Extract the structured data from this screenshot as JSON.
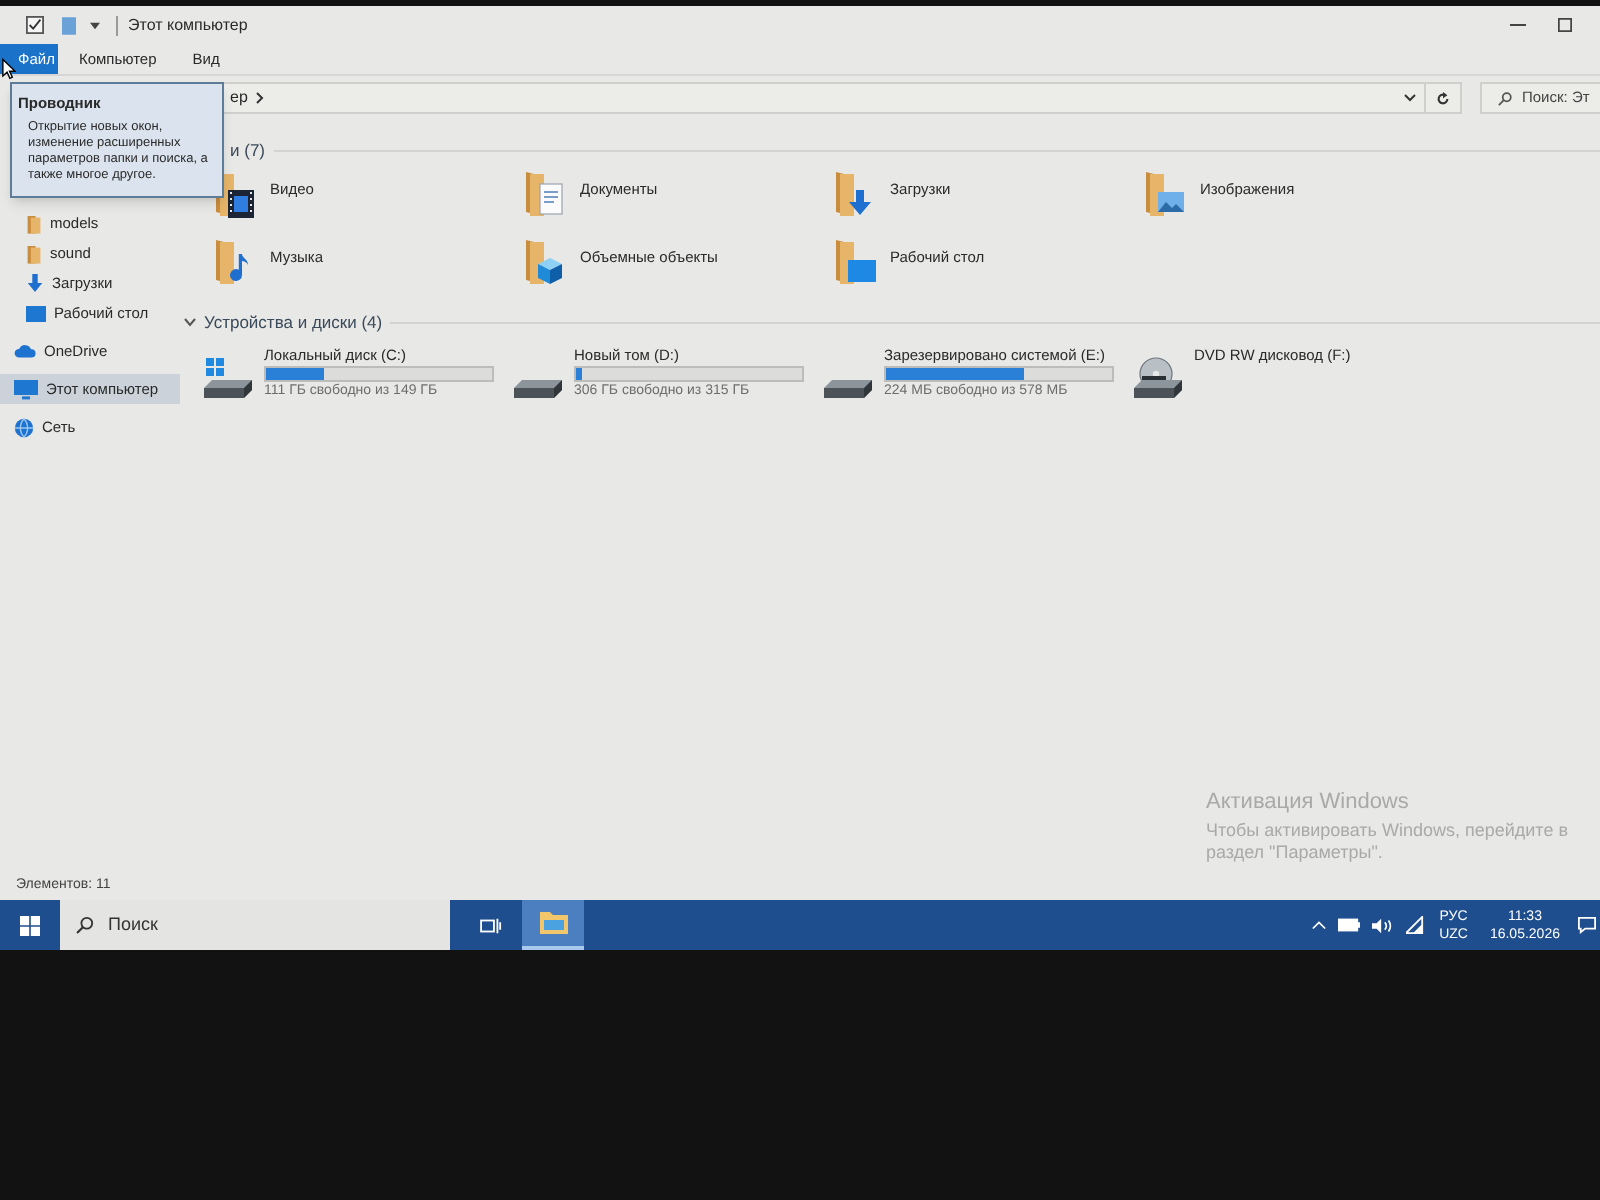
{
  "window": {
    "title": "Этот компьютер"
  },
  "ribbon_tabs": [
    {
      "label": "Файл",
      "kind": "menu"
    },
    {
      "label": "Компьютер",
      "kind": "tab"
    },
    {
      "label": "Вид",
      "kind": "tab"
    }
  ],
  "address_bar": {
    "path": "ер"
  },
  "search": {
    "placeholder": "Поиск: Эт"
  },
  "tooltip": {
    "title": "Проводник",
    "text": "Открытие новых окон, изменение расширенных параметров папки и поиска, а также многое другое."
  },
  "sidebar": {
    "sections": [
      {
        "items": [
          {
            "label": "models",
            "kind": "folder",
            "selected": false
          },
          {
            "label": "sound",
            "kind": "folder",
            "selected": false
          },
          {
            "label": "Загрузки",
            "kind": "downloads",
            "selected": false
          },
          {
            "label": "Рабочий стол",
            "kind": "desktop",
            "selected": false
          }
        ]
      },
      {
        "items": [
          {
            "label": "OneDrive",
            "kind": "cloud",
            "selected": false
          }
        ]
      },
      {
        "items": [
          {
            "label": "Этот компьютер",
            "kind": "computer",
            "selected": true
          }
        ]
      },
      {
        "items": [
          {
            "label": "Сеть",
            "kind": "network",
            "selected": false
          }
        ]
      }
    ]
  },
  "folders": {
    "header": "и (7)",
    "items": [
      {
        "label": "Видео",
        "kind": "video"
      },
      {
        "label": "Документы",
        "kind": "documents"
      },
      {
        "label": "Загрузки",
        "kind": "downloads"
      },
      {
        "label": "Изображения",
        "kind": "pictures"
      },
      {
        "label": "Музыка",
        "kind": "music"
      },
      {
        "label": "Объемные объекты",
        "kind": "objects3d"
      },
      {
        "label": "Рабочий стол",
        "kind": "desktop"
      }
    ]
  },
  "drives": {
    "header": "Устройства и диски (4)",
    "expanded": true,
    "items": [
      {
        "label": "Локальный диск (C:)",
        "kind": "system",
        "level": 0.26,
        "reading": "111 ГБ свободно из 149 ГБ"
      },
      {
        "label": "Новый том (D:)",
        "kind": "disk",
        "level": 0.03,
        "reading": "306 ГБ свободно из 315 ГБ"
      },
      {
        "label": "Зарезервировано системой (E:)",
        "kind": "disk",
        "level": 0.61,
        "reading": "224 МБ свободно из 578 МБ"
      },
      {
        "label": "DVD RW дисковод (F:)",
        "kind": "dvd"
      }
    ]
  },
  "status_bar": {
    "text": "Элементов: 11"
  },
  "taskbar": {
    "search_placeholder": "Поиск",
    "apps": [
      {
        "kind": "task-view",
        "selected": false
      },
      {
        "kind": "explorer",
        "selected": true
      }
    ],
    "language": "РУС",
    "layout": "UZC",
    "time": "11:33",
    "date": "16.05.2026"
  },
  "activation": {
    "title": "Активация Windows",
    "text": "Чтобы активировать Windows, перейдите в раздел \"Параметры\"."
  }
}
